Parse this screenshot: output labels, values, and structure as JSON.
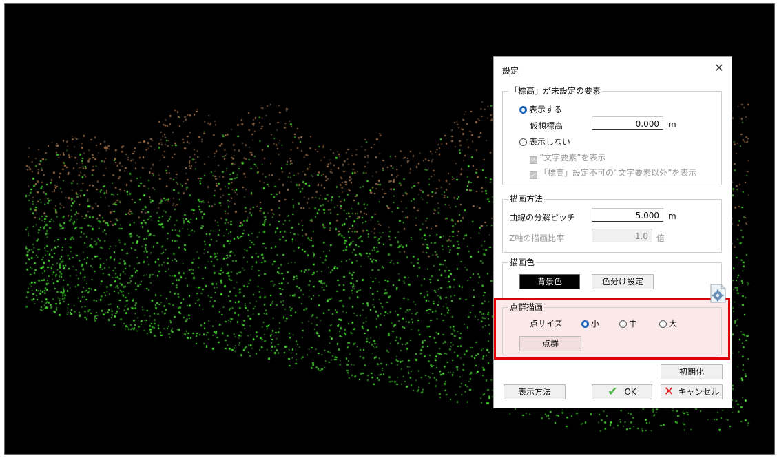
{
  "dialog": {
    "title": "設定",
    "close_icon": "close-icon",
    "elevation_group": {
      "legend": "「標高」が未設定の要素",
      "show_label": "表示する",
      "virtual_elevation_label": "仮想標高",
      "virtual_elevation_value": "0.000",
      "unit_m": "m",
      "hide_label": "表示しない",
      "show_text_elements": "“文字要素”を表示",
      "show_non_text_elements": "「標高」設定不可の“文字要素以外”を表示"
    },
    "draw_method_group": {
      "legend": "描画方法",
      "curve_pitch_label": "曲線の分解ピッチ",
      "curve_pitch_value": "5.000",
      "unit_m": "m",
      "z_ratio_label": "Z軸の描画比率",
      "z_ratio_value": "1.0",
      "z_ratio_unit": "倍"
    },
    "draw_color_group": {
      "legend": "描画色",
      "background_color_button": "背景色",
      "color_split_button": "色分け設定"
    },
    "point_cloud_group": {
      "legend": "点群描画",
      "point_size_label": "点サイズ",
      "size_small": "小",
      "size_medium": "中",
      "size_large": "大",
      "selected_size": "小",
      "point_cloud_button": "点群"
    },
    "buttons": {
      "reset": "初期化",
      "display_method": "表示方法",
      "ok": "OK",
      "cancel": "キャンセル"
    },
    "highlight_color": "#e00000"
  }
}
